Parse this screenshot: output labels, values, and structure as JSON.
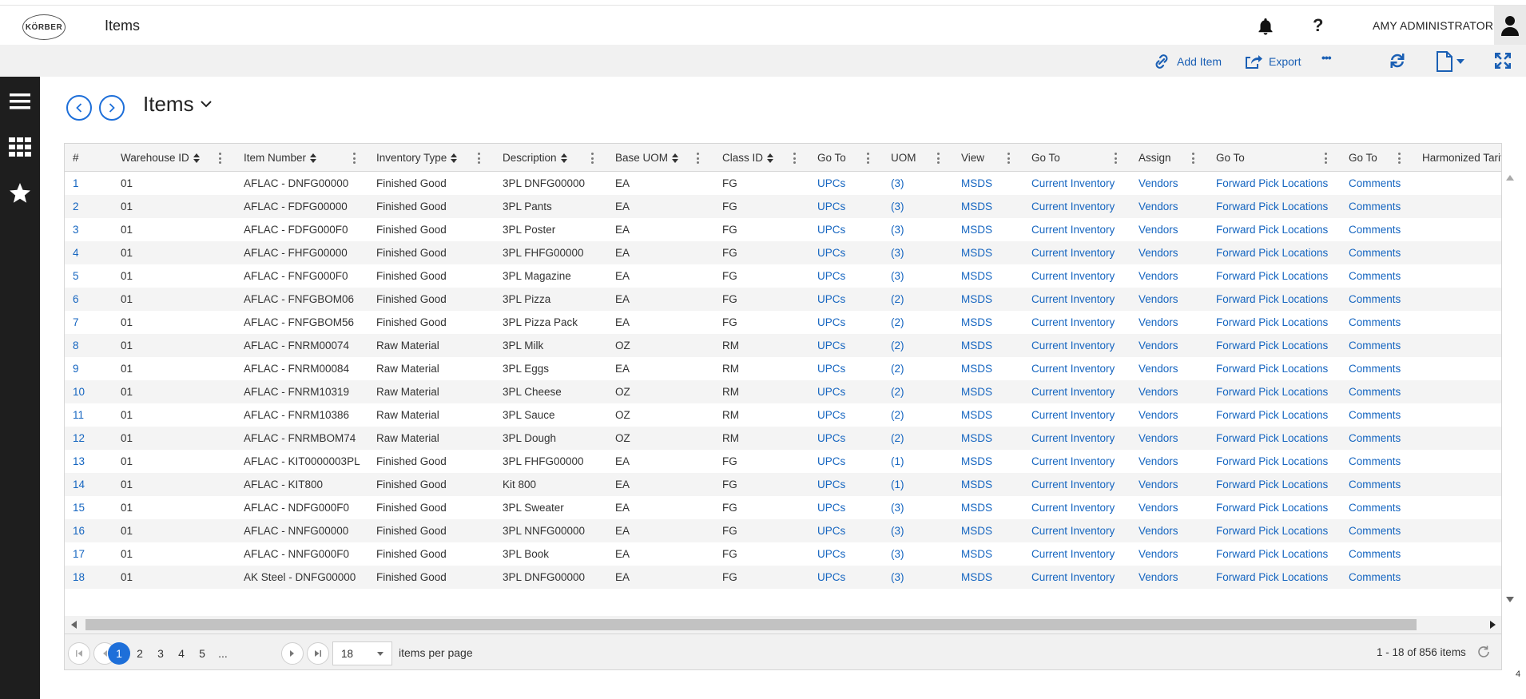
{
  "header": {
    "logo_text": "KÖRBER",
    "app_title": "Items",
    "user_name": "AMY ADMINISTRATOR",
    "help_label": "?"
  },
  "toolbar": {
    "add_item_label": "Add Item",
    "export_label": "Export",
    "more_label": "•••"
  },
  "page": {
    "title": "Items"
  },
  "grid": {
    "columns": [
      {
        "label": "#"
      },
      {
        "label": "Warehouse ID"
      },
      {
        "label": "Item Number"
      },
      {
        "label": "Inventory Type"
      },
      {
        "label": "Description"
      },
      {
        "label": "Base UOM"
      },
      {
        "label": "Class ID"
      },
      {
        "label": "Go To"
      },
      {
        "label": "UOM"
      },
      {
        "label": "View"
      },
      {
        "label": "Go To"
      },
      {
        "label": "Assign"
      },
      {
        "label": "Go To"
      },
      {
        "label": "Go To"
      },
      {
        "label": "Harmonized Tarif"
      }
    ],
    "rows": [
      {
        "num": "1",
        "wh": "01",
        "item": "AFLAC - DNFG00000",
        "type": "Finished Good",
        "desc": "3PL DNFG00000",
        "uom": "EA",
        "cls": "FG",
        "upcs": "UPCs",
        "uomc": "(3)",
        "msds": "MSDS",
        "inv": "Current Inventory",
        "vend": "Vendors",
        "fpl": "Forward Pick Locations",
        "comm": "Comments"
      },
      {
        "num": "2",
        "wh": "01",
        "item": "AFLAC - FDFG00000",
        "type": "Finished Good",
        "desc": "3PL Pants",
        "uom": "EA",
        "cls": "FG",
        "upcs": "UPCs",
        "uomc": "(3)",
        "msds": "MSDS",
        "inv": "Current Inventory",
        "vend": "Vendors",
        "fpl": "Forward Pick Locations",
        "comm": "Comments"
      },
      {
        "num": "3",
        "wh": "01",
        "item": "AFLAC - FDFG000F0",
        "type": "Finished Good",
        "desc": "3PL Poster",
        "uom": "EA",
        "cls": "FG",
        "upcs": "UPCs",
        "uomc": "(3)",
        "msds": "MSDS",
        "inv": "Current Inventory",
        "vend": "Vendors",
        "fpl": "Forward Pick Locations",
        "comm": "Comments"
      },
      {
        "num": "4",
        "wh": "01",
        "item": "AFLAC - FHFG00000",
        "type": "Finished Good",
        "desc": "3PL FHFG00000",
        "uom": "EA",
        "cls": "FG",
        "upcs": "UPCs",
        "uomc": "(3)",
        "msds": "MSDS",
        "inv": "Current Inventory",
        "vend": "Vendors",
        "fpl": "Forward Pick Locations",
        "comm": "Comments"
      },
      {
        "num": "5",
        "wh": "01",
        "item": "AFLAC - FNFG000F0",
        "type": "Finished Good",
        "desc": "3PL Magazine",
        "uom": "EA",
        "cls": "FG",
        "upcs": "UPCs",
        "uomc": "(3)",
        "msds": "MSDS",
        "inv": "Current Inventory",
        "vend": "Vendors",
        "fpl": "Forward Pick Locations",
        "comm": "Comments"
      },
      {
        "num": "6",
        "wh": "01",
        "item": "AFLAC - FNFGBOM06",
        "type": "Finished Good",
        "desc": "3PL Pizza",
        "uom": "EA",
        "cls": "FG",
        "upcs": "UPCs",
        "uomc": "(2)",
        "msds": "MSDS",
        "inv": "Current Inventory",
        "vend": "Vendors",
        "fpl": "Forward Pick Locations",
        "comm": "Comments"
      },
      {
        "num": "7",
        "wh": "01",
        "item": "AFLAC - FNFGBOM56",
        "type": "Finished Good",
        "desc": "3PL Pizza Pack",
        "uom": "EA",
        "cls": "FG",
        "upcs": "UPCs",
        "uomc": "(2)",
        "msds": "MSDS",
        "inv": "Current Inventory",
        "vend": "Vendors",
        "fpl": "Forward Pick Locations",
        "comm": "Comments"
      },
      {
        "num": "8",
        "wh": "01",
        "item": "AFLAC - FNRM00074",
        "type": "Raw Material",
        "desc": "3PL Milk",
        "uom": "OZ",
        "cls": "RM",
        "upcs": "UPCs",
        "uomc": "(2)",
        "msds": "MSDS",
        "inv": "Current Inventory",
        "vend": "Vendors",
        "fpl": "Forward Pick Locations",
        "comm": "Comments"
      },
      {
        "num": "9",
        "wh": "01",
        "item": "AFLAC - FNRM00084",
        "type": "Raw Material",
        "desc": "3PL Eggs",
        "uom": "EA",
        "cls": "RM",
        "upcs": "UPCs",
        "uomc": "(2)",
        "msds": "MSDS",
        "inv": "Current Inventory",
        "vend": "Vendors",
        "fpl": "Forward Pick Locations",
        "comm": "Comments"
      },
      {
        "num": "10",
        "wh": "01",
        "item": "AFLAC - FNRM10319",
        "type": "Raw Material",
        "desc": "3PL Cheese",
        "uom": "OZ",
        "cls": "RM",
        "upcs": "UPCs",
        "uomc": "(2)",
        "msds": "MSDS",
        "inv": "Current Inventory",
        "vend": "Vendors",
        "fpl": "Forward Pick Locations",
        "comm": "Comments"
      },
      {
        "num": "11",
        "wh": "01",
        "item": "AFLAC - FNRM10386",
        "type": "Raw Material",
        "desc": "3PL Sauce",
        "uom": "OZ",
        "cls": "RM",
        "upcs": "UPCs",
        "uomc": "(2)",
        "msds": "MSDS",
        "inv": "Current Inventory",
        "vend": "Vendors",
        "fpl": "Forward Pick Locations",
        "comm": "Comments"
      },
      {
        "num": "12",
        "wh": "01",
        "item": "AFLAC - FNRMBOM74",
        "type": "Raw Material",
        "desc": "3PL Dough",
        "uom": "OZ",
        "cls": "RM",
        "upcs": "UPCs",
        "uomc": "(2)",
        "msds": "MSDS",
        "inv": "Current Inventory",
        "vend": "Vendors",
        "fpl": "Forward Pick Locations",
        "comm": "Comments"
      },
      {
        "num": "13",
        "wh": "01",
        "item": "AFLAC - KIT0000003PL",
        "type": "Finished Good",
        "desc": "3PL FHFG00000",
        "uom": "EA",
        "cls": "FG",
        "upcs": "UPCs",
        "uomc": "(1)",
        "msds": "MSDS",
        "inv": "Current Inventory",
        "vend": "Vendors",
        "fpl": "Forward Pick Locations",
        "comm": "Comments"
      },
      {
        "num": "14",
        "wh": "01",
        "item": "AFLAC - KIT800",
        "type": "Finished Good",
        "desc": "Kit 800",
        "uom": "EA",
        "cls": "FG",
        "upcs": "UPCs",
        "uomc": "(1)",
        "msds": "MSDS",
        "inv": "Current Inventory",
        "vend": "Vendors",
        "fpl": "Forward Pick Locations",
        "comm": "Comments"
      },
      {
        "num": "15",
        "wh": "01",
        "item": "AFLAC - NDFG000F0",
        "type": "Finished Good",
        "desc": "3PL Sweater",
        "uom": "EA",
        "cls": "FG",
        "upcs": "UPCs",
        "uomc": "(3)",
        "msds": "MSDS",
        "inv": "Current Inventory",
        "vend": "Vendors",
        "fpl": "Forward Pick Locations",
        "comm": "Comments"
      },
      {
        "num": "16",
        "wh": "01",
        "item": "AFLAC - NNFG00000",
        "type": "Finished Good",
        "desc": "3PL NNFG00000",
        "uom": "EA",
        "cls": "FG",
        "upcs": "UPCs",
        "uomc": "(3)",
        "msds": "MSDS",
        "inv": "Current Inventory",
        "vend": "Vendors",
        "fpl": "Forward Pick Locations",
        "comm": "Comments"
      },
      {
        "num": "17",
        "wh": "01",
        "item": "AFLAC - NNFG000F0",
        "type": "Finished Good",
        "desc": "3PL Book",
        "uom": "EA",
        "cls": "FG",
        "upcs": "UPCs",
        "uomc": "(3)",
        "msds": "MSDS",
        "inv": "Current Inventory",
        "vend": "Vendors",
        "fpl": "Forward Pick Locations",
        "comm": "Comments"
      },
      {
        "num": "18",
        "wh": "01",
        "item": "AK Steel - DNFG00000",
        "type": "Finished Good",
        "desc": "3PL DNFG00000",
        "uom": "EA",
        "cls": "FG",
        "upcs": "UPCs",
        "uomc": "(3)",
        "msds": "MSDS",
        "inv": "Current Inventory",
        "vend": "Vendors",
        "fpl": "Forward Pick Locations",
        "comm": "Comments"
      }
    ]
  },
  "pager": {
    "pages": [
      "1",
      "2",
      "3",
      "4",
      "5",
      "..."
    ],
    "current_page": "1",
    "page_size": "18",
    "items_per_page_label": "items per page",
    "info": "1 - 18 of 856 items"
  },
  "footer": {
    "corner_number": "4"
  },
  "colors": {
    "accent": "#1e6fd9",
    "link": "#1565c0",
    "sidebar": "#1e1e1e"
  },
  "icons": {
    "bell": "bell-icon",
    "user": "user-icon",
    "add_item": "link-icon",
    "export": "export-icon",
    "refresh": "refresh-icon",
    "document": "document-icon",
    "fullscreen": "expand-icon",
    "menu": "hamburger-icon",
    "apps": "grid-icon",
    "favorites": "star-icon"
  }
}
